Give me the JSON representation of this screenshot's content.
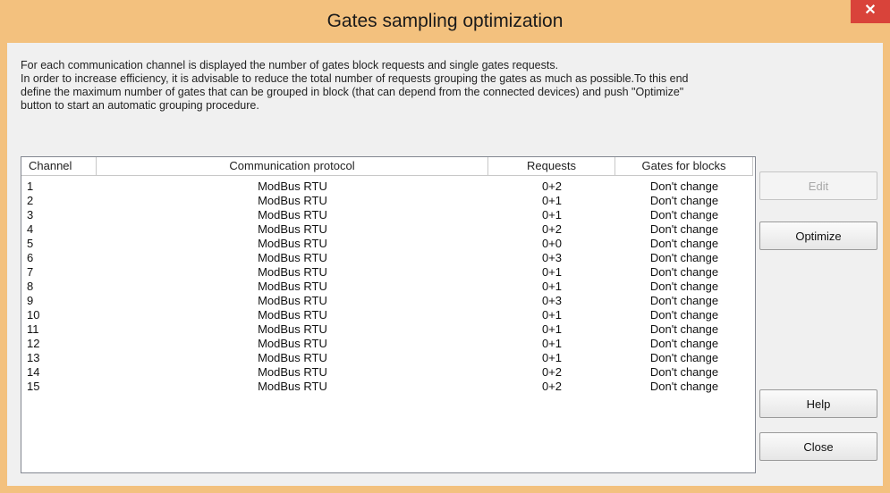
{
  "window": {
    "title": "Gates sampling optimization",
    "close_glyph": "✕"
  },
  "description": [
    "For each communication channel is displayed the number of gates block requests and single gates requests.",
    "In order to increase efficiency, it is advisable to reduce the total number of requests grouping the gates as much as possible.To this end",
    "define the maximum number of gates that can be grouped in block (that can depend from the connected devices) and push \"Optimize\"",
    "button to start an automatic grouping procedure."
  ],
  "table": {
    "columns": [
      "Channel",
      "Communication protocol",
      "Requests",
      "Gates for blocks"
    ],
    "rows": [
      [
        "1",
        "ModBus RTU",
        "0+2",
        "Don't change"
      ],
      [
        "2",
        "ModBus RTU",
        "0+1",
        "Don't change"
      ],
      [
        "3",
        "ModBus RTU",
        "0+1",
        "Don't change"
      ],
      [
        "4",
        "ModBus RTU",
        "0+2",
        "Don't change"
      ],
      [
        "5",
        "ModBus RTU",
        "0+0",
        "Don't change"
      ],
      [
        "6",
        "ModBus RTU",
        "0+3",
        "Don't change"
      ],
      [
        "7",
        "ModBus RTU",
        "0+1",
        "Don't change"
      ],
      [
        "8",
        "ModBus RTU",
        "0+1",
        "Don't change"
      ],
      [
        "9",
        "ModBus RTU",
        "0+3",
        "Don't change"
      ],
      [
        "10",
        "ModBus RTU",
        "0+1",
        "Don't change"
      ],
      [
        "11",
        "ModBus RTU",
        "0+1",
        "Don't change"
      ],
      [
        "12",
        "ModBus RTU",
        "0+1",
        "Don't change"
      ],
      [
        "13",
        "ModBus RTU",
        "0+1",
        "Don't change"
      ],
      [
        "14",
        "ModBus RTU",
        "0+2",
        "Don't change"
      ],
      [
        "15",
        "ModBus RTU",
        "0+2",
        "Don't change"
      ]
    ]
  },
  "buttons": {
    "edit": "Edit",
    "optimize": "Optimize",
    "help": "Help",
    "close": "Close"
  },
  "colors": {
    "title_bar": "#f3c17e",
    "close_button": "#d9433a"
  }
}
